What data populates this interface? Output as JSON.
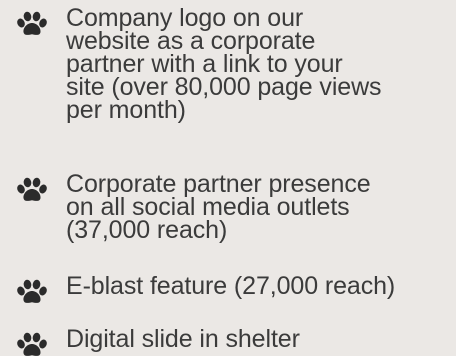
{
  "list": {
    "bullet_icon": "paw-print-icon",
    "bullet_color": "#2b2b2b",
    "text_color": "#3b3b3b",
    "background": "#ebe8e5",
    "items": [
      {
        "text": "Company logo on our\nwebsite as a corporate\npartner with a link to your\nsite (over 80,000 page views\nper month)"
      },
      {
        "text": "Corporate partner presence\non all social media outlets\n(37,000 reach)"
      },
      {
        "text": "E-blast feature (27,000 reach)"
      },
      {
        "text": "Digital slide in shelter"
      }
    ]
  }
}
